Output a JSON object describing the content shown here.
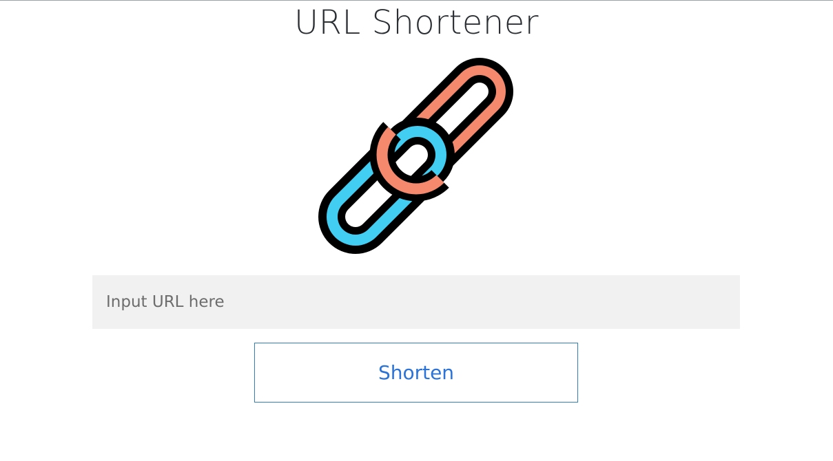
{
  "header": {
    "title": "URL Shortener"
  },
  "logo": {
    "icon": "chain-link-icon",
    "colors": {
      "top_link": "#F4896E",
      "bottom_link": "#41CEF2",
      "outline": "#000000"
    }
  },
  "form": {
    "url_placeholder": "Input URL here",
    "url_value": "",
    "shorten_label": "Shorten"
  },
  "colors": {
    "button_text": "#2b73d6",
    "button_border": "#2f7dba",
    "input_background": "#f1f1f1"
  }
}
